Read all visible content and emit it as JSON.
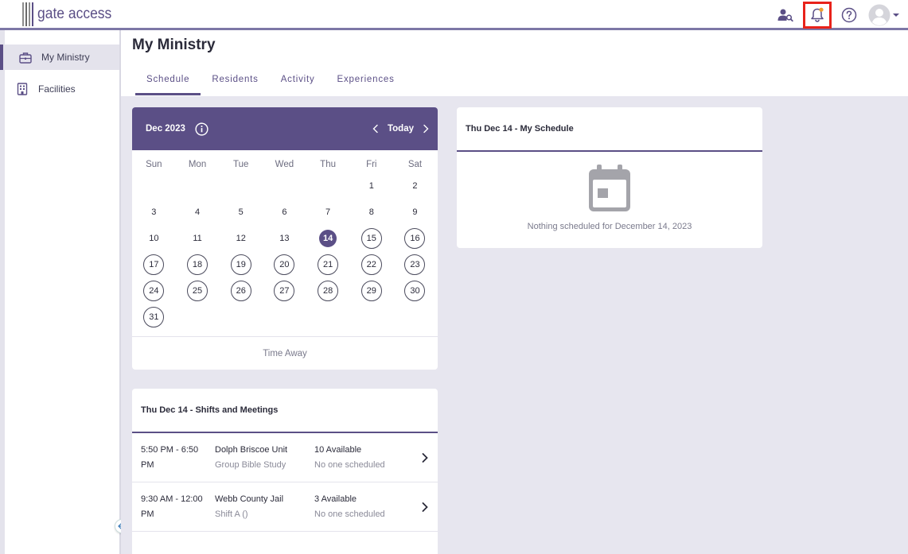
{
  "app": {
    "logo_text": "gate access"
  },
  "topbar": {
    "icons": [
      "user-search-icon",
      "bell-icon",
      "help-icon",
      "avatar-icon",
      "caret-down-icon"
    ],
    "notification_dot_color": "#f0a030",
    "highlight_color": "#e8221b"
  },
  "sidebar": {
    "items": [
      {
        "label": "My Ministry",
        "icon": "briefcase-icon",
        "active": true
      },
      {
        "label": "Facilities",
        "icon": "building-icon",
        "active": false
      }
    ]
  },
  "page": {
    "title": "My Ministry",
    "tabs": [
      {
        "label": "Schedule",
        "active": true
      },
      {
        "label": "Residents",
        "active": false
      },
      {
        "label": "Activity",
        "active": false
      },
      {
        "label": "Experiences",
        "active": false
      }
    ]
  },
  "calendar": {
    "month_label": "Dec 2023",
    "today_label": "Today",
    "weekdays": [
      "Sun",
      "Mon",
      "Tue",
      "Wed",
      "Thu",
      "Fri",
      "Sat"
    ],
    "first_weekday_index": 5,
    "days_in_month": 31,
    "today": 14,
    "available_from": 15,
    "time_away_label": "Time Away"
  },
  "my_schedule": {
    "title": "Thu Dec 14 - My Schedule",
    "empty_text": "Nothing scheduled for December 14, 2023"
  },
  "shifts": {
    "title": "Thu Dec 14 - Shifts and Meetings",
    "rows": [
      {
        "time_line1": "5:50 PM - 6:50",
        "time_line2": "PM",
        "location": "Dolph Briscoe Unit",
        "event": "Group Bible Study",
        "available": "10 Available",
        "scheduled": "No one scheduled"
      },
      {
        "time_line1": "9:30 AM - 12:00",
        "time_line2": "PM",
        "location": "Webb County Jail",
        "event": "Shift A ()",
        "available": "3 Available",
        "scheduled": "No one scheduled"
      }
    ]
  },
  "colors": {
    "brand": "#5b4f86",
    "background": "#e7e6ef"
  }
}
